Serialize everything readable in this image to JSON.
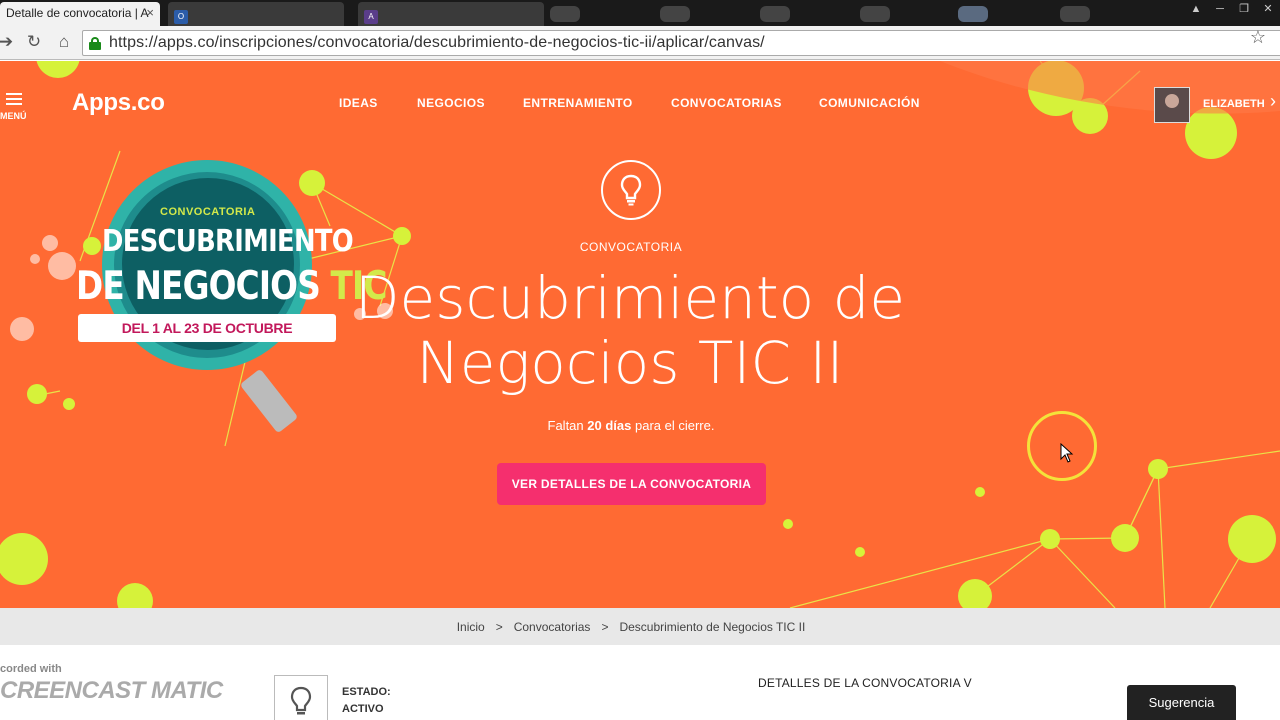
{
  "browser": {
    "tabs": [
      {
        "title": "Detalle de convocatoria | A",
        "active": true
      },
      {
        "title": "",
        "active": false
      },
      {
        "title": "",
        "active": false
      }
    ],
    "url": "https://apps.co/inscripciones/convocatoria/descubrimiento-de-negocios-tic-ii/aplicar/canvas/",
    "close_glyph": "×",
    "window_controls": [
      "▲",
      "─",
      "❐",
      "✕"
    ]
  },
  "header": {
    "menu_label": "MENÚ",
    "logo": "Apps.co",
    "nav": [
      "IDEAS",
      "NEGOCIOS",
      "ENTRENAMIENTO",
      "CONVOCATORIAS",
      "COMUNICACIÓN"
    ],
    "user_name": "ELIZABETH"
  },
  "badge": {
    "eyebrow": "CONVOCATORIA",
    "line1": "DESCUBRIMIENTO",
    "line2": "DE NEGOCIOS",
    "line2_accent": "TIC",
    "dates": "DEL 1 AL 23 DE OCTUBRE"
  },
  "hero": {
    "eyebrow": "CONVOCATORIA",
    "title": "Descubrimiento de Negocios TIC II",
    "closing_prefix": "Faltan",
    "closing_days": "20 días",
    "closing_suffix": "para el cierre.",
    "cta_label": "VER DETALLES DE LA CONVOCATORIA"
  },
  "breadcrumb": {
    "items": [
      "Inicio",
      "Convocatorias",
      "Descubrimiento de Negocios TIC II"
    ],
    "separator": ">"
  },
  "status": {
    "label": "ESTADO:",
    "value": "ACTIVO"
  },
  "details": {
    "heading": "DETALLES DE LA CONVOCATORIA V"
  },
  "watermark": {
    "line1": "corded with",
    "line2": "CREENCAST MATIC"
  },
  "feedback": {
    "label": "Sugerencia"
  },
  "colors": {
    "hero_bg": "#ff6a33",
    "accent_lime": "#d6f23a",
    "cta": "#f52f6e"
  },
  "icons": {
    "bulb": "lightbulb-icon",
    "menu": "hamburger-icon",
    "lock": "lock-icon",
    "star": "bookmark-star-icon"
  }
}
